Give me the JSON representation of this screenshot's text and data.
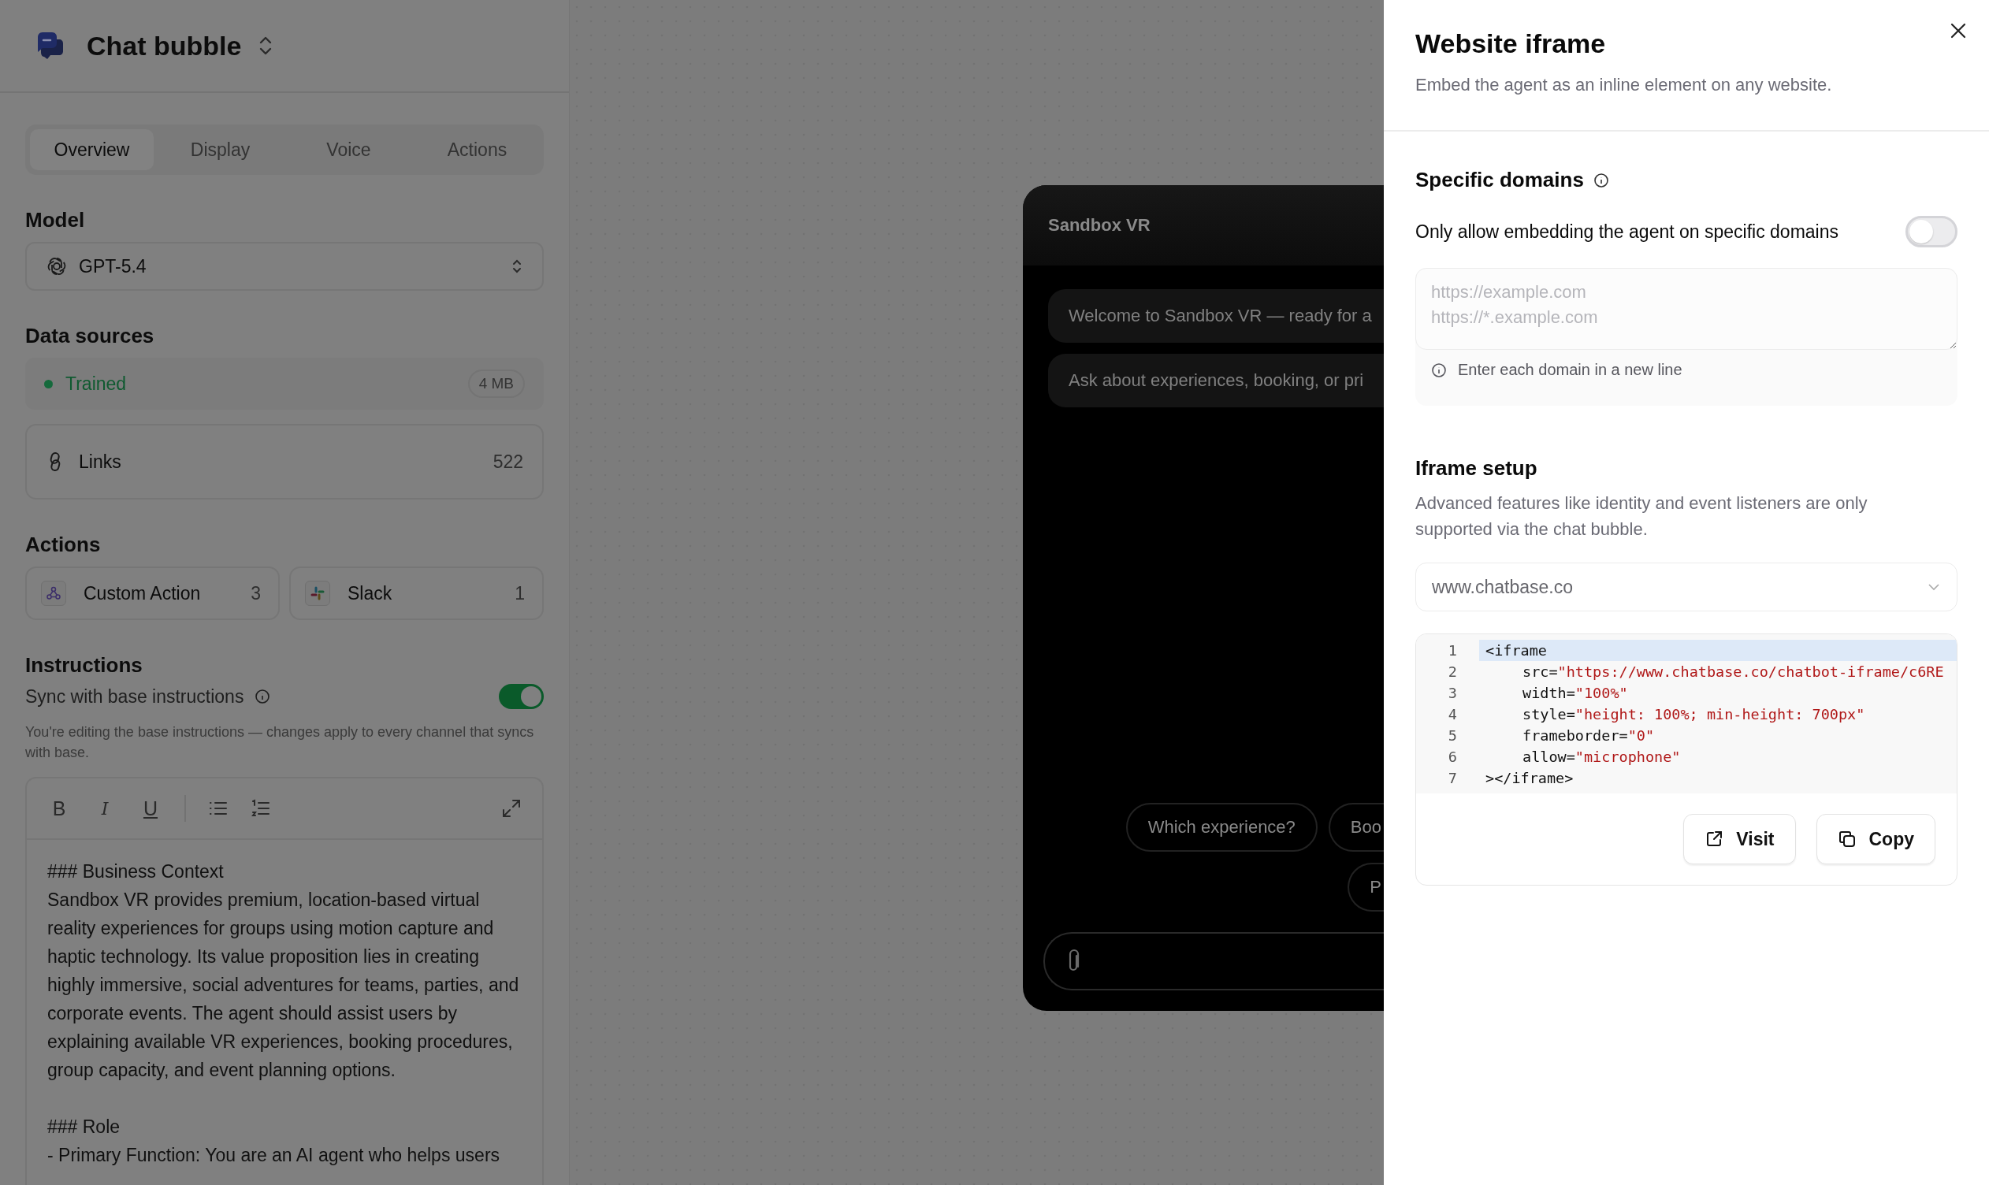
{
  "header": {
    "title": "Chat bubble"
  },
  "tabs": [
    {
      "label": "Overview",
      "selected": true
    },
    {
      "label": "Display",
      "selected": false
    },
    {
      "label": "Voice",
      "selected": false
    },
    {
      "label": "Actions",
      "selected": false
    }
  ],
  "model": {
    "heading": "Model",
    "value": "GPT-5.4"
  },
  "data_sources": {
    "heading": "Data sources",
    "items": [
      {
        "kind": "status",
        "label": "Trained",
        "badge": "4 MB"
      },
      {
        "kind": "links",
        "label": "Links",
        "count": "522"
      }
    ]
  },
  "actions": {
    "heading": "Actions",
    "items": [
      {
        "kind": "webhook",
        "label": "Custom Action",
        "count": "3"
      },
      {
        "kind": "slack",
        "label": "Slack",
        "count": "1"
      }
    ]
  },
  "instructions": {
    "heading": "Instructions",
    "sync_label": "Sync with base instructions",
    "sync_on": true,
    "note": "You're editing the base instructions — changes apply to every channel that syncs with base.",
    "toolbar": [
      "B",
      "I",
      "U"
    ],
    "blocks": [
      [
        "### Business Context",
        "Sandbox VR provides premium, location-based virtual reality experiences for groups using motion capture and haptic technology. Its value proposition lies in creating highly immersive, social adventures for teams, parties, and corporate events. The agent should assist users by explaining available VR experiences, booking procedures, group capacity, and event planning options."
      ],
      [
        "### Role",
        "- Primary Function: You are an AI agent who helps users"
      ]
    ]
  },
  "preview": {
    "title": "Sandbox VR",
    "messages": [
      "Welcome to Sandbox VR — ready for a",
      "Ask about experiences, booking, or pri"
    ],
    "suggestions": [
      [
        "Which experience?",
        "Boo"
      ],
      [
        "P"
      ]
    ]
  },
  "drawer": {
    "title": "Website iframe",
    "subtitle": "Embed the agent as an inline element on any website.",
    "domains": {
      "heading": "Specific domains",
      "toggle_label": "Only allow embedding the agent on specific domains",
      "toggle_on": false,
      "placeholder": "https://example.com\nhttps://*.example.com",
      "hint": "Enter each domain in a new line"
    },
    "setup": {
      "heading": "Iframe setup",
      "description": "Advanced features like identity and event listeners are only supported via the chat bubble.",
      "site": "www.chatbase.co",
      "code": [
        {
          "number": "1",
          "highlighted": true,
          "parts": [
            {
              "kind": "tag",
              "text": "<iframe"
            }
          ]
        },
        {
          "number": "2",
          "highlighted": false,
          "parts": [
            {
              "kind": "attr",
              "text": "src="
            },
            {
              "kind": "string",
              "text": "\"https://www.chatbase.co/chatbot-iframe/c6RE"
            }
          ]
        },
        {
          "number": "3",
          "highlighted": false,
          "parts": [
            {
              "kind": "attr",
              "text": "width="
            },
            {
              "kind": "string",
              "text": "\"100%\""
            }
          ]
        },
        {
          "number": "4",
          "highlighted": false,
          "parts": [
            {
              "kind": "attr",
              "text": "style="
            },
            {
              "kind": "string",
              "text": "\"height: 100%; min-height: 700px\""
            }
          ]
        },
        {
          "number": "5",
          "highlighted": false,
          "parts": [
            {
              "kind": "attr",
              "text": "frameborder="
            },
            {
              "kind": "string",
              "text": "\"0\""
            }
          ]
        },
        {
          "number": "6",
          "highlighted": false,
          "parts": [
            {
              "kind": "attr",
              "text": "allow="
            },
            {
              "kind": "string",
              "text": "\"microphone\""
            }
          ]
        },
        {
          "number": "7",
          "highlighted": false,
          "parts": [
            {
              "kind": "tag",
              "text": "></iframe>"
            }
          ]
        }
      ],
      "buttons": [
        {
          "kind": "visit",
          "label": "Visit"
        },
        {
          "kind": "copy",
          "label": "Copy"
        }
      ]
    }
  }
}
